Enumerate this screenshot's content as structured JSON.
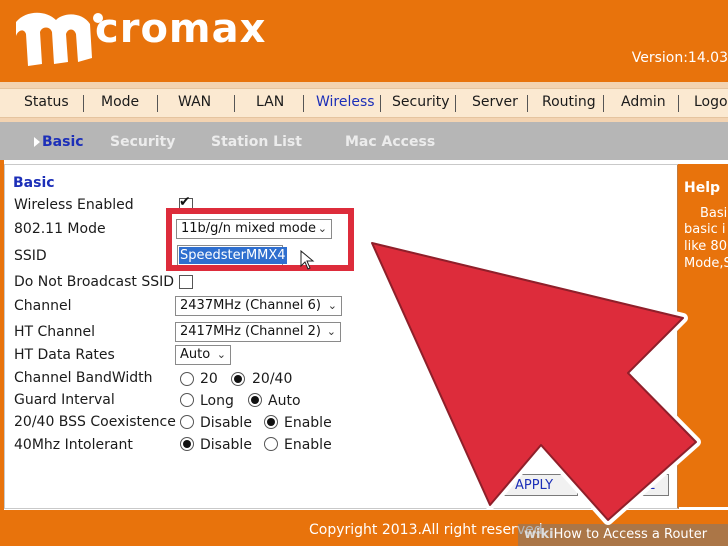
{
  "header": {
    "brand": "cromax",
    "version": "Version:14.03"
  },
  "nav": {
    "items": [
      "Status",
      "Mode",
      "WAN",
      "LAN",
      "Wireless",
      "Security",
      "Server",
      "Routing",
      "Admin",
      "Logo"
    ],
    "active": "Wireless"
  },
  "subnav": {
    "items": [
      "Basic",
      "Security",
      "Station List",
      "Mac Access"
    ],
    "active": "Basic"
  },
  "form": {
    "section_title": "Basic",
    "wireless_enabled_label": "Wireless Enabled",
    "wireless_enabled": true,
    "mode_label": "802.11 Mode",
    "mode_value": "11b/g/n mixed mode",
    "ssid_label": "SSID",
    "ssid_value": "SpeedsterMMX4",
    "hide_ssid_label": "Do Not Broadcast SSID",
    "hide_ssid": false,
    "channel_label": "Channel",
    "channel_value": "2437MHz (Channel 6)",
    "ht_channel_label": "HT Channel",
    "ht_channel_value": "2417MHz (Channel 2)",
    "ht_rates_label": "HT Data Rates",
    "ht_rates_value": "Auto",
    "bandwidth_label": "Channel BandWidth",
    "bandwidth_options": [
      "20",
      "20/40"
    ],
    "bandwidth_selected": "20/40",
    "guard_label": "Guard Interval",
    "guard_options": [
      "Long",
      "Auto"
    ],
    "guard_selected": "Auto",
    "coex_label": "20/40 BSS Coexistence",
    "coex_options": [
      "Disable",
      "Enable"
    ],
    "coex_selected": "Enable",
    "intolerant_label": "40Mhz Intolerant",
    "intolerant_options": [
      "Disable",
      "Enable"
    ],
    "intolerant_selected": "Disable",
    "apply_label": "APPLY",
    "cancel_label": "CANCEL"
  },
  "help": {
    "title": "Help",
    "lines": [
      "Basi",
      "basic i",
      "like 80",
      "Mode,S"
    ]
  },
  "footer": {
    "copyright": "Copyright 2013.All right reserved",
    "watermark_wiki": "wiki",
    "watermark_text": "How to Access a Router"
  },
  "colors": {
    "brand_orange": "#e8730c",
    "accent_blue": "#1c2fb8",
    "highlight_red": "#dd2c3b"
  }
}
